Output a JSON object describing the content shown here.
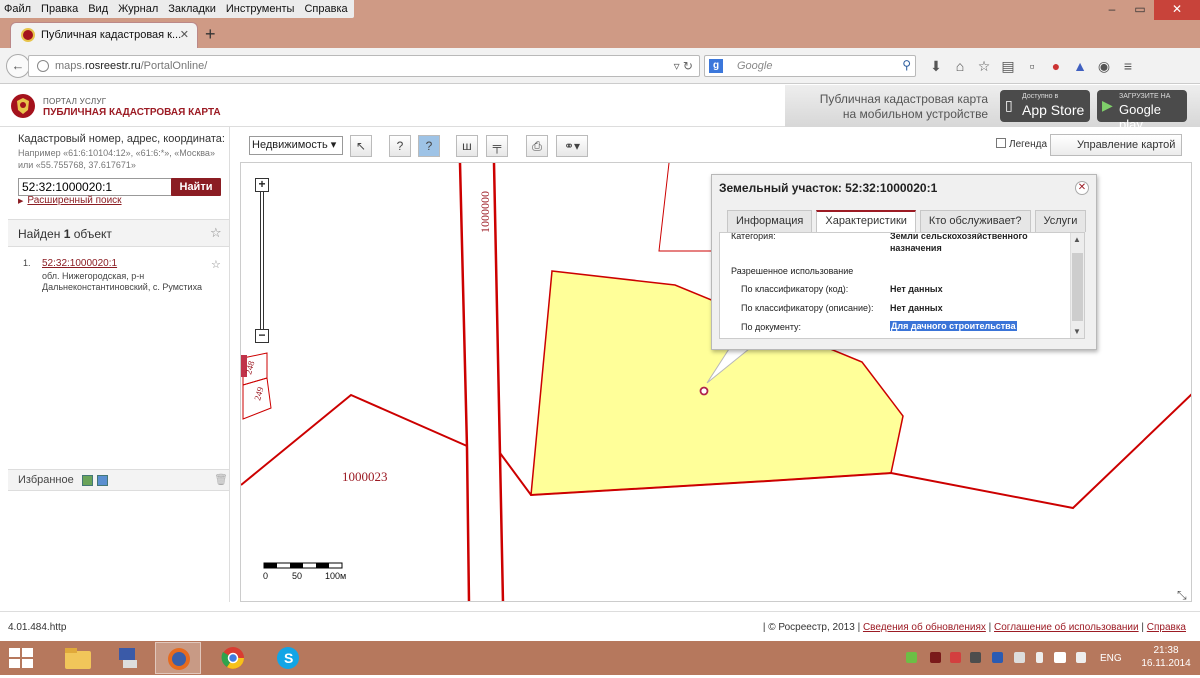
{
  "browser": {
    "menu": [
      "Файл",
      "Правка",
      "Вид",
      "Журнал",
      "Закладки",
      "Инструменты",
      "Справка"
    ],
    "tab_title": "Публичная кадастровая к...",
    "url_prefix": "maps.",
    "url_domain": "rosreestr.ru",
    "url_path": "/PortalOnline/",
    "search_placeholder": "Google"
  },
  "site": {
    "portal_label": "ПОРТАЛ УСЛУГ",
    "portal_title": "ПУБЛИЧНАЯ КАДАСТРОВАЯ КАРТА",
    "mobile_line1": "Публичная кадастровая карта",
    "mobile_line2": "на мобильном устройстве",
    "appstore_small": "Доступно в",
    "appstore_big": "App Store",
    "gplay_small": "ЗАГРУЗИТЕ НА",
    "gplay_big": "Google play"
  },
  "search": {
    "title": "Кадастровый номер, адрес, координата:",
    "hint": "Например «61:6:10104:12», «61:6:*», «Москва» или «55.755768, 37.617671»",
    "value": "52:32:1000020:1",
    "button": "Найти",
    "advanced": "Расширенный поиск"
  },
  "results": {
    "found_prefix": "Найден ",
    "found_count": "1",
    "found_suffix": " объект",
    "items": [
      {
        "num": "1.",
        "cad": "52:32:1000020:1",
        "address": "обл. Нижегородская, р-н Дальнеконстантиновский, с. Румстиха"
      }
    ]
  },
  "favorites": {
    "label": "Избранное"
  },
  "toolbar": {
    "layer_select": "Недвижимость",
    "legend": "Легенда",
    "map_control": "Управление картой"
  },
  "map": {
    "labels": {
      "block_vertical": "1000000",
      "block_left": "1000023",
      "parcel_248": "248",
      "parcel_249": "249"
    },
    "scale": {
      "l0": "0",
      "l1": "50",
      "l2": "100м"
    }
  },
  "popup": {
    "title": "Земельный участок: 52:32:1000020:1",
    "tabs": [
      "Информация",
      "Характеристики",
      "Кто обслуживает?",
      "Услуги"
    ],
    "active_tab": 1,
    "category_label": "Категория:",
    "category_value_1": "Земли сельскохозяйственного",
    "category_value_2": "назначения",
    "permitted_use": "Разрешенное использование",
    "rows": [
      {
        "label": "По классификатору (код):",
        "value": "Нет данных"
      },
      {
        "label": "По классификатору (описание):",
        "value": "Нет данных"
      },
      {
        "label": "По документу:",
        "value": "Для дачного строительства"
      }
    ]
  },
  "footer": {
    "version": "4.01.484.http",
    "copyright": "| © Росреестр, 2013 |",
    "links": [
      "Сведения об обновлениях",
      "Соглашение об использовании",
      "Справка"
    ]
  },
  "taskbar": {
    "lang": "ENG",
    "time": "21:38",
    "date": "16.11.2014"
  },
  "colors": {
    "brand": "#9c1b24",
    "parcel_fill": "#ffff99",
    "boundary": "#cc0000",
    "selection": "#3a74d8"
  }
}
